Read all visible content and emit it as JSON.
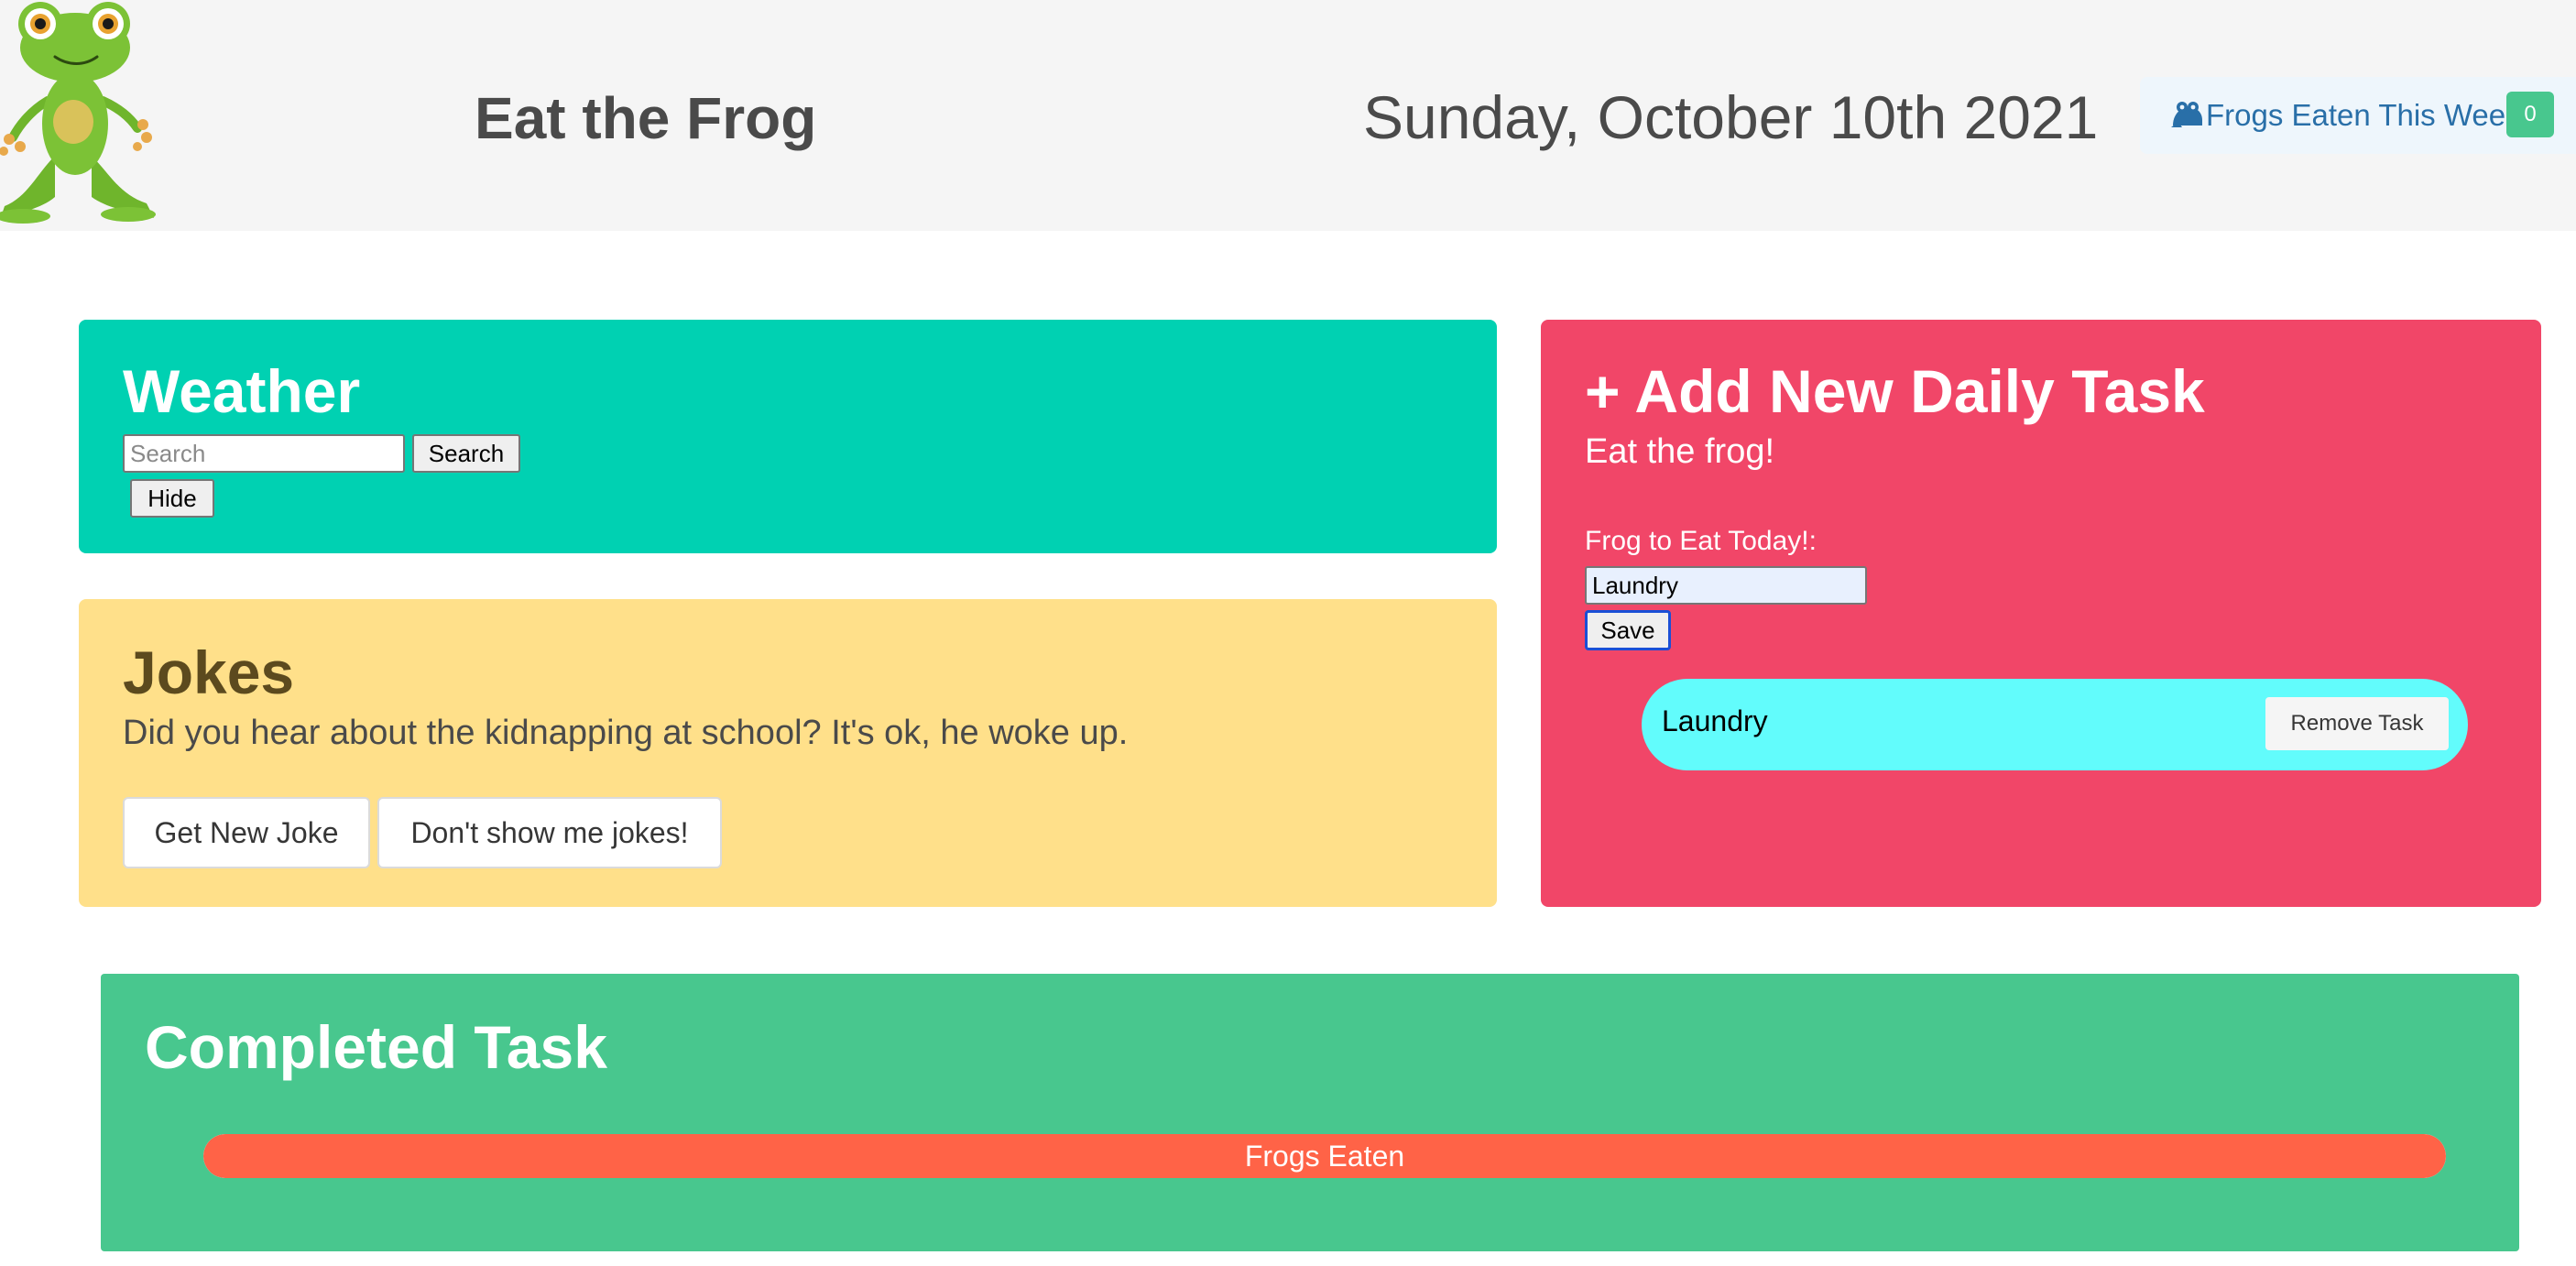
{
  "header": {
    "app_title": "Eat the Frog",
    "date": "Sunday, October 10th 2021",
    "frogs_eaten_label": "Frogs Eaten This Week",
    "frogs_eaten_count": "0",
    "logo_icon": "frog-mascot-logo",
    "counter_icon": "frog-icon"
  },
  "weather": {
    "title": "Weather",
    "search_placeholder": "Search",
    "search_value": "",
    "search_button": "Search",
    "hide_button": "Hide"
  },
  "jokes": {
    "title": "Jokes",
    "joke": "Did you hear about the kidnapping at school? It's ok, he woke up.",
    "get_new_button": "Get New Joke",
    "hide_button": "Don't show me jokes!"
  },
  "task": {
    "title": "+ Add New Daily Task",
    "subtitle": "Eat the frog!",
    "input_label": "Frog to Eat Today!:",
    "input_value": "Laundry",
    "save_button": "Save",
    "items": [
      {
        "label": "Laundry",
        "remove_button": "Remove Task"
      }
    ]
  },
  "completed": {
    "title": "Completed Task",
    "progress_label": "Frogs Eaten",
    "progress_value": 1.0
  },
  "colors": {
    "weather_card": "#00d1b2",
    "jokes_card": "#ffe08a",
    "task_card": "#f14668",
    "completed_card": "#48c78e",
    "task_item": "#62fcfc",
    "progress_fill": "#ff6347",
    "counter_badge": "#48c78e",
    "link_blue": "#296fa8"
  }
}
